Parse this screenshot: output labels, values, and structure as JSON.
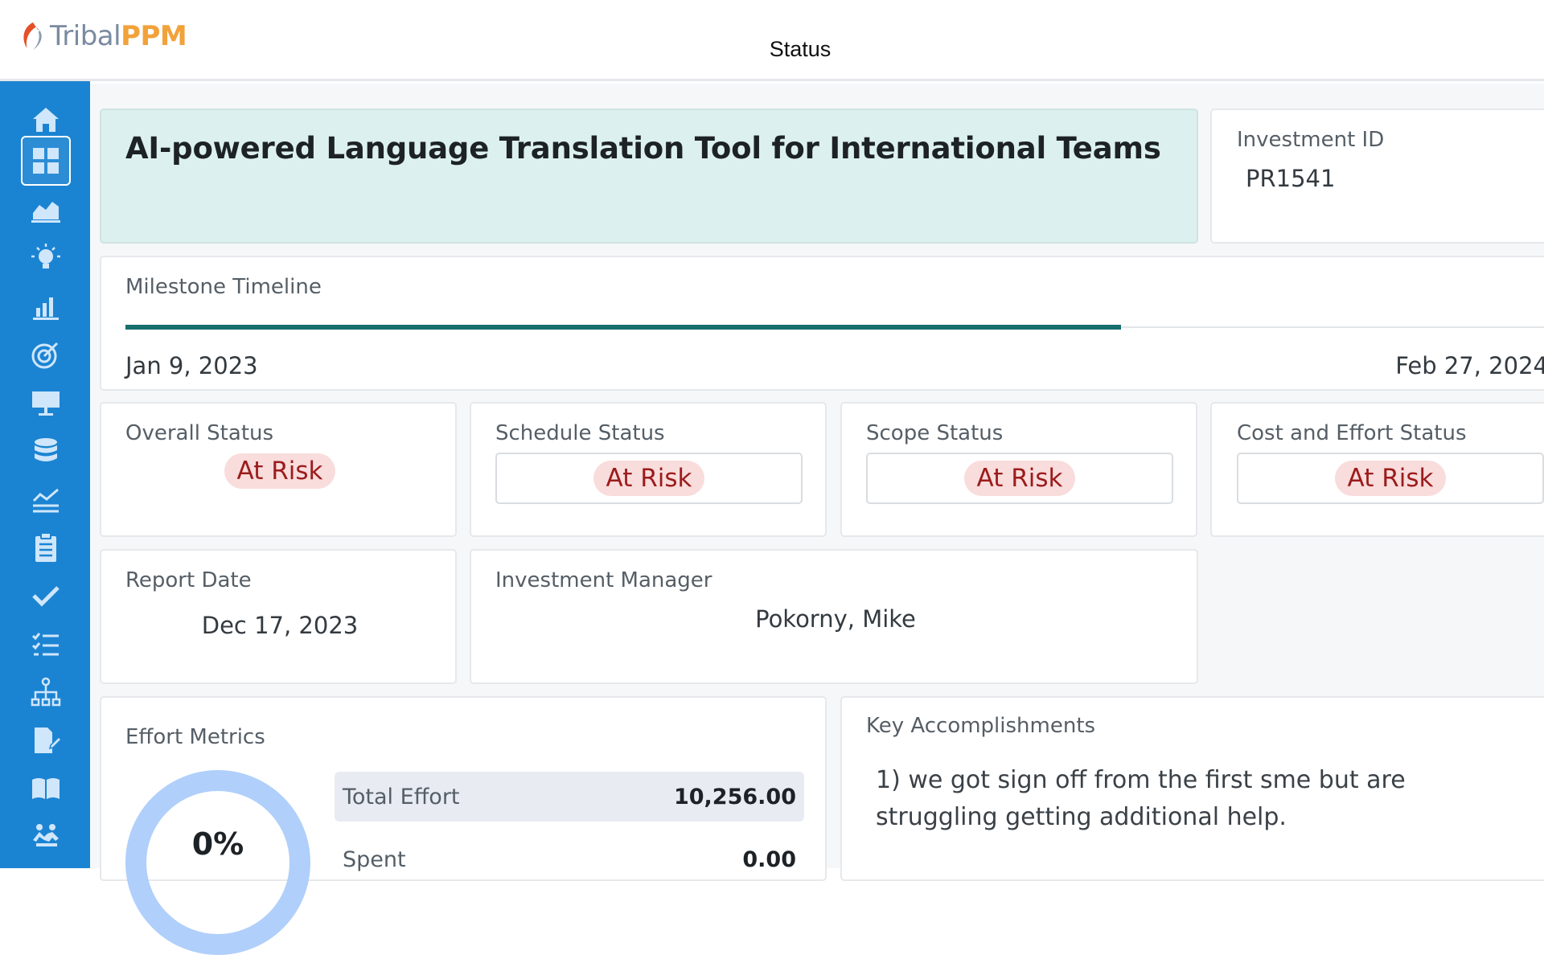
{
  "header": {
    "logo_tribal": "Tribal",
    "logo_ppm": "PPM",
    "page_title": "Status"
  },
  "sidebar": {
    "items": [
      {
        "icon": "home-icon",
        "active": false
      },
      {
        "icon": "dashboard-icon",
        "active": true
      },
      {
        "icon": "area-chart-icon",
        "active": false
      },
      {
        "icon": "lightbulb-icon",
        "active": false
      },
      {
        "icon": "bar-chart-icon",
        "active": false
      },
      {
        "icon": "target-icon",
        "active": false
      },
      {
        "icon": "presentation-icon",
        "active": false
      },
      {
        "icon": "database-icon",
        "active": false
      },
      {
        "icon": "line-chart-icon",
        "active": false
      },
      {
        "icon": "clipboard-icon",
        "active": false
      },
      {
        "icon": "check-icon",
        "active": false
      },
      {
        "icon": "checklist-icon",
        "active": false
      },
      {
        "icon": "hierarchy-icon",
        "active": false
      },
      {
        "icon": "document-edit-icon",
        "active": false
      },
      {
        "icon": "book-icon",
        "active": false
      },
      {
        "icon": "people-icon",
        "active": false
      }
    ]
  },
  "investment": {
    "title": "AI-powered Language Translation Tool for International Teams",
    "id_label": "Investment ID",
    "id_value": "PR1541"
  },
  "milestone": {
    "label": "Milestone Timeline",
    "start_date": "Jan 9, 2023",
    "end_date": "Feb 27, 2024",
    "progress_fraction": 0.7
  },
  "statuses": {
    "overall": {
      "label": "Overall Status",
      "value": "At Risk"
    },
    "schedule": {
      "label": "Schedule Status",
      "value": "At Risk"
    },
    "scope": {
      "label": "Scope Status",
      "value": "At Risk"
    },
    "cost": {
      "label": "Cost and Effort Status",
      "value": "At Risk"
    }
  },
  "report": {
    "label": "Report Date",
    "value": "Dec 17, 2023"
  },
  "manager": {
    "label": "Investment Manager",
    "value": "Pokorny, Mike"
  },
  "effort": {
    "label": "Effort Metrics",
    "gauge_value": "0%",
    "rows": [
      {
        "label": "Total Effort",
        "value": "10,256.00"
      },
      {
        "label": "Spent",
        "value": "0.00"
      }
    ]
  },
  "accomplishments": {
    "label": "Key Accomplishments",
    "text": "1) we got sign off from the first sme but are struggling getting additional help."
  },
  "colors": {
    "sidebar": "#1b84d2",
    "title_bg": "#dcf1ef",
    "timeline": "#176f6c",
    "risk_bg": "#f9dcdc",
    "risk_text": "#9b1c1c",
    "gauge": "#b0cffb",
    "logo_orange": "#f2a23a"
  }
}
